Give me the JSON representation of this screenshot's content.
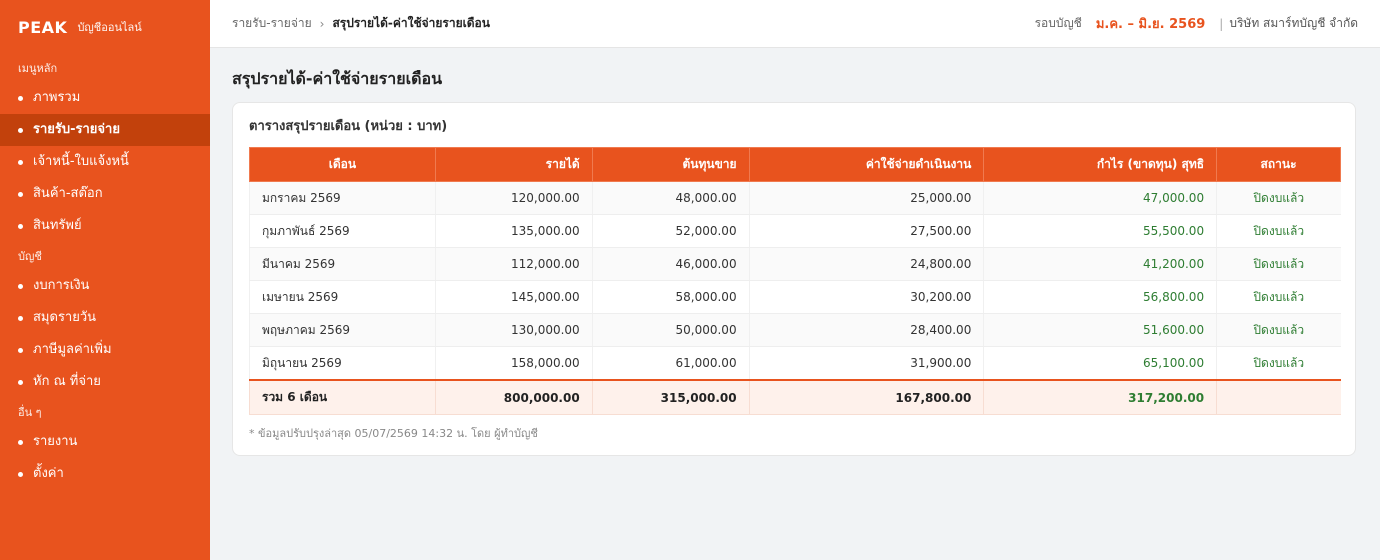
{
  "brand": {
    "logo": "PEAK",
    "subtitle": "บัญชีออนไลน์"
  },
  "sidebar": {
    "sections": [
      {
        "label": "เมนูหลัก",
        "items": [
          {
            "label": "ภาพรวม",
            "active": false
          },
          {
            "label": "รายรับ-รายจ่าย",
            "active": true
          },
          {
            "label": "เจ้าหนี้-ใบแจ้งหนี้",
            "active": false
          },
          {
            "label": "สินค้า-สต๊อก",
            "active": false
          },
          {
            "label": "สินทรัพย์",
            "active": false
          }
        ]
      },
      {
        "label": "บัญชี",
        "items": [
          {
            "label": "งบการเงิน",
            "active": false
          },
          {
            "label": "สมุดรายวัน",
            "active": false
          },
          {
            "label": "ภาษีมูลค่าเพิ่ม",
            "active": false
          },
          {
            "label": "หัก ณ ที่จ่าย",
            "active": false
          }
        ]
      },
      {
        "label": "อื่น ๆ",
        "items": [
          {
            "label": "รายงาน",
            "active": false
          },
          {
            "label": "ตั้งค่า",
            "active": false
          }
        ]
      }
    ]
  },
  "topbar": {
    "breadcrumb_parent": "รายรับ-รายจ่าย",
    "breadcrumb_sep": "›",
    "breadcrumb_current": "สรุปรายได้-ค่าใช้จ่ายรายเดือน",
    "period_label": "รอบบัญชี",
    "period_value": "ม.ค. – มิ.ย. 2569",
    "company_sep": "|",
    "company": "บริษัท สมาร์ทบัญชี จำกัด"
  },
  "page": {
    "title": "สรุปรายได้-ค่าใช้จ่ายรายเดือน",
    "card_title": "ตารางสรุปรายเดือน (หน่วย : บาท)",
    "footnote": "* ข้อมูลปรับปรุงล่าสุด 05/07/2569 14:32 น. โดย ผู้ทำบัญชี"
  },
  "table": {
    "headers": [
      "เดือน",
      "รายได้",
      "ต้นทุนขาย",
      "ค่าใช้จ่ายดำเนินงาน",
      "กำไร (ขาดทุน) สุทธิ",
      "สถานะ"
    ],
    "rows": [
      [
        "มกราคม 2569",
        "120,000.00",
        "48,000.00",
        "25,000.00",
        "47,000.00",
        "ปิดงบแล้ว"
      ],
      [
        "กุมภาพันธ์ 2569",
        "135,000.00",
        "52,000.00",
        "27,500.00",
        "55,500.00",
        "ปิดงบแล้ว"
      ],
      [
        "มีนาคม 2569",
        "112,000.00",
        "46,000.00",
        "24,800.00",
        "41,200.00",
        "ปิดงบแล้ว"
      ],
      [
        "เมษายน 2569",
        "145,000.00",
        "58,000.00",
        "30,200.00",
        "56,800.00",
        "ปิดงบแล้ว"
      ],
      [
        "พฤษภาคม 2569",
        "130,000.00",
        "50,000.00",
        "28,400.00",
        "51,600.00",
        "ปิดงบแล้ว"
      ],
      [
        "มิถุนายน 2569",
        "158,000.00",
        "61,000.00",
        "31,900.00",
        "65,100.00",
        "ปิดงบแล้ว"
      ]
    ],
    "total": [
      "รวม 6 เดือน",
      "800,000.00",
      "315,000.00",
      "167,800.00",
      "317,200.00",
      ""
    ]
  },
  "colors": {
    "brand": "#e8531e",
    "brand_dark": "#c2410c",
    "profit": "#2e7d32"
  }
}
